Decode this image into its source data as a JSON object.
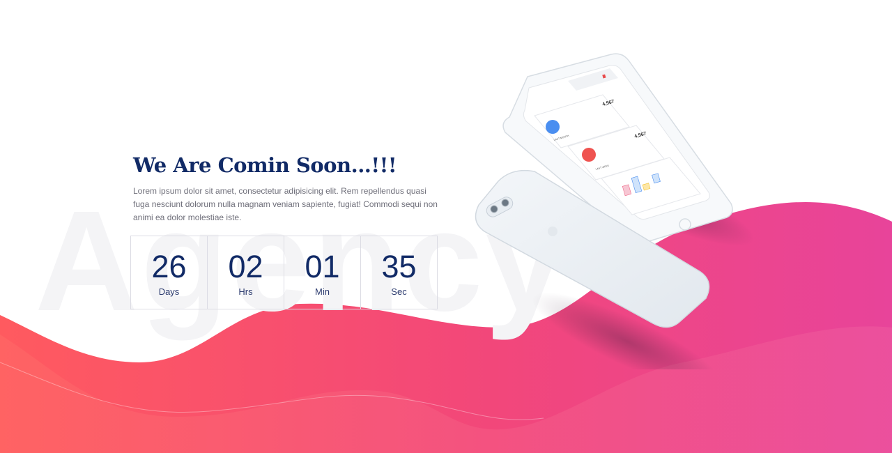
{
  "hero": {
    "watermark": "Agency",
    "headline": "We Are Comin Soon...!!!",
    "description": "Lorem ipsum dolor sit amet, consectetur adipisicing elit. Rem repellendus quasi fuga nesciunt dolorum nulla magnam veniam sapiente, fugiat! Commodi sequi non animi ea dolor molestiae iste."
  },
  "countdown": [
    {
      "value": "26",
      "label": "Days"
    },
    {
      "value": "02",
      "label": "Hrs"
    },
    {
      "value": "01",
      "label": "Min"
    },
    {
      "value": "35",
      "label": "Sec"
    }
  ],
  "phone_screen": {
    "card1_value": "4,567",
    "card1_label": "LAST MONTH",
    "card2_value": "4,567",
    "card2_label": "LAST WEEK"
  },
  "colors": {
    "heading": "#112a66",
    "wave_start": "#ff5a5f",
    "wave_end": "#e94a9a",
    "text": "#6f6f7a"
  }
}
